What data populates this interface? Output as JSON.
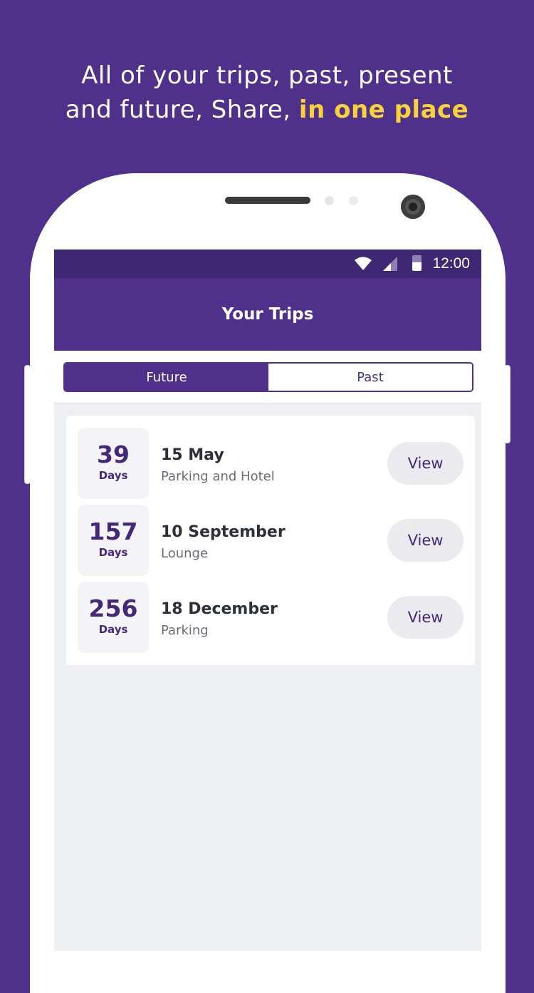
{
  "headline": {
    "line1": "All of your trips, past, present",
    "line2_plain": "and future, Share, ",
    "line2_accent": "in one place"
  },
  "status_bar": {
    "time": "12:00"
  },
  "app_bar": {
    "title": "Your Trips"
  },
  "tabs": {
    "future": "Future",
    "past": "Past",
    "selected": "Future"
  },
  "trips": [
    {
      "days": "39",
      "days_label": "Days",
      "date": "15 May",
      "type": "Parking and Hotel",
      "action": "View"
    },
    {
      "days": "157",
      "days_label": "Days",
      "date": "10 September",
      "type": "Lounge",
      "action": "View"
    },
    {
      "days": "256",
      "days_label": "Days",
      "date": "18 December",
      "type": "Parking",
      "action": "View"
    }
  ],
  "colors": {
    "background": "#4f318b",
    "accent": "#f9d13a",
    "status_bar": "#3e2873",
    "primary_text": "#452978"
  }
}
